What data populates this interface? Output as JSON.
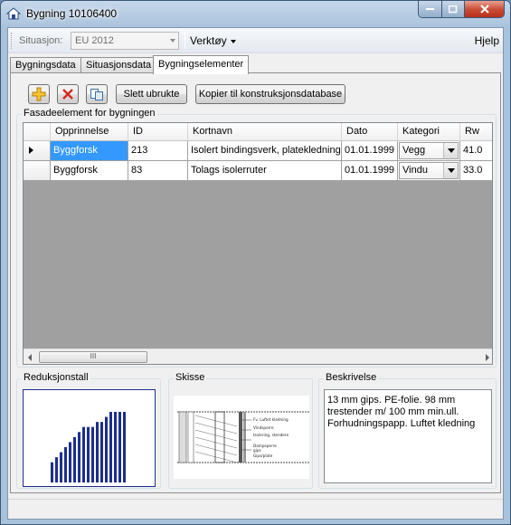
{
  "window": {
    "title": "Bygning 10106400"
  },
  "toolbar": {
    "situasjon_label": "Situasjon:",
    "situasjon_value": "EU 2012",
    "verktoy_label": "Verktøy",
    "hjelp_label": "Hjelp"
  },
  "tabs": [
    {
      "label": "Bygningsdata",
      "active": false
    },
    {
      "label": "Situasjonsdata",
      "active": false
    },
    {
      "label": "Bygningselementer",
      "active": true
    }
  ],
  "actions": {
    "add_icon": "add-icon",
    "delete_icon": "delete-icon",
    "copy_icon": "copy-icon",
    "slett_label": "Slett ubrukte",
    "kopier_label": "Kopier til konstruksjonsdatabase"
  },
  "fasade": {
    "group_title": "Fasadeelement for bygningen",
    "columns": [
      "Opprinnelse",
      "ID",
      "Kortnavn",
      "Dato",
      "Kategori",
      "Rw"
    ],
    "rows": [
      {
        "opprinnelse": "Byggforsk",
        "id": "213",
        "kortnavn": "Isolert bindingsverk, platekledning",
        "dato": "01.01.1999",
        "kategori": "Vegg",
        "rw": "41.0",
        "current": true
      },
      {
        "opprinnelse": "Byggforsk",
        "id": "83",
        "kortnavn": "Tolags isolerruter",
        "dato": "01.01.1999",
        "kategori": "Vindu",
        "rw": "33.0",
        "current": false
      }
    ],
    "scroll_thumb": "III"
  },
  "reduksjonstall": {
    "title": "Reduksjonstall",
    "chart_data": {
      "type": "bar",
      "values": [
        4,
        5,
        6,
        7,
        8,
        9,
        10,
        11,
        11,
        11,
        12,
        12,
        13,
        14,
        14,
        14,
        14
      ]
    }
  },
  "skisse": {
    "title": "Skisse",
    "legend_lines": [
      "Fv. Luftet kledning",
      "Vindsperre",
      "Isolering, stendere",
      "Dampsperre",
      "gips",
      "Gips/plate"
    ]
  },
  "beskrivelse": {
    "title": "Beskrivelse",
    "text": "13 mm gips. PE-folie. 98 mm trestender m/ 100 mm min.ull. Forhudningspapp. Luftet kledning"
  },
  "colors": {
    "selection": "#3399ff",
    "bar": "#1c2e8c",
    "grid_bg": "#a0a0a0"
  }
}
